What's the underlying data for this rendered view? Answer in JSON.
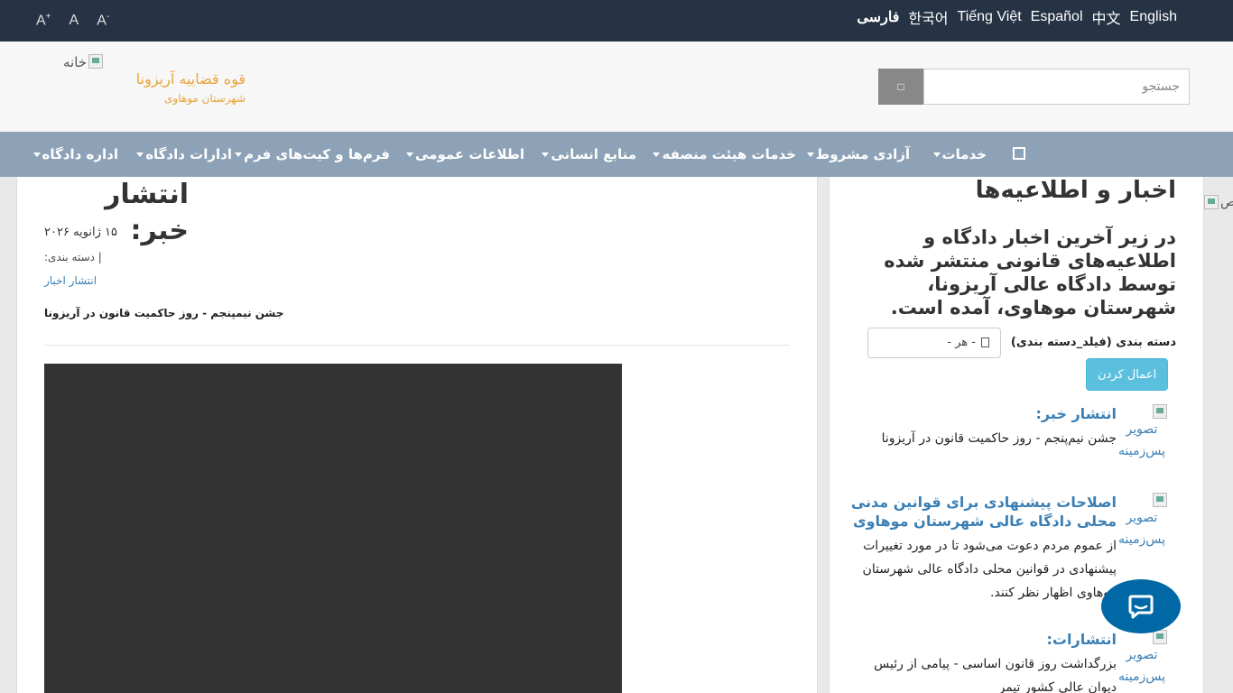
{
  "topbar": {
    "font_controls": {
      "increase": "A",
      "increase_sup": "+",
      "normal": "A",
      "decrease": "A",
      "decrease_sup": "-"
    },
    "languages": [
      "فارسی",
      "한국어",
      "Tiếng Việt",
      "Español",
      "中文",
      "English"
    ]
  },
  "header": {
    "logo_alt": "خانه",
    "org_name": "قوه قضاییه آریزونا",
    "org_sub": "شهرستان موهاوی",
    "search": {
      "placeholder": "جستجو",
      "button_icon": "search-icon"
    }
  },
  "nav": {
    "items": [
      {
        "label": "خدمات",
        "dropdown": true
      },
      {
        "label": "آزادی مشروط",
        "dropdown": true
      },
      {
        "label": "خدمات هیئت منصفه",
        "dropdown": true
      },
      {
        "label": "منابع انسانی",
        "dropdown": true
      },
      {
        "label": "اطلاعات عمومی",
        "dropdown": true
      },
      {
        "label": "فرم‌ها و کیت‌های فرم",
        "dropdown": true
      },
      {
        "label": "ادارات دادگاه",
        "dropdown": true
      },
      {
        "label": "اداره دادگاه",
        "dropdown": true
      }
    ]
  },
  "article": {
    "title": "انتشار خبر:",
    "date": "۱۵ ژانویه ۲۰۲۶",
    "category_label": "| دسته بندی:",
    "category_link": "انتشار اخبار",
    "summary": "جشن نیمپنجم - روز حاکمیت قانون در آریزونا"
  },
  "sidebar": {
    "title": "اخبار و اطلاعیه‌ها",
    "intro": "در زیر آخرین اخبار دادگاه و اطلاعیه‌های قانونی منتشر شده توسط دادگاه عالی آریزونا، شهرستان موهاوی، آمده است.",
    "filter_label": "دسته بندی (فیلد_دسته بندی)",
    "filter_value": "- هر -",
    "apply_label": "اعمال کردن",
    "thumb_alt_1": "تصویر",
    "thumb_alt_2": "پس‌زمینه",
    "news": [
      {
        "title": "انتشار خبر:",
        "text": "جشن نیم‌پنجم - روز حاکمیت قانون در آریزونا"
      },
      {
        "title": "اصلاحات پیشنهادی برای قوانین مدنی محلی دادگاه عالی شهرستان موهاوی",
        "text": "از عموم مردم دعوت می‌شود تا در مورد تغییرات پیشنهادی در قوانین محلی دادگاه عالی شهرستان موهاوی اظهار نظر کنند."
      },
      {
        "title": "انتشارات:",
        "text": "بزرگداشت روز قانون اساسی - پیامی از رئیس دیوان عالی کشور تیمر"
      }
    ]
  },
  "edge_img_alt": "تص",
  "colors": {
    "topbar": "#263345",
    "nav": "#8ea2b7",
    "accent_gold": "#e8a43c",
    "link": "#3a7fb5",
    "apply": "#5bc0de",
    "chat": "#0068a5"
  }
}
